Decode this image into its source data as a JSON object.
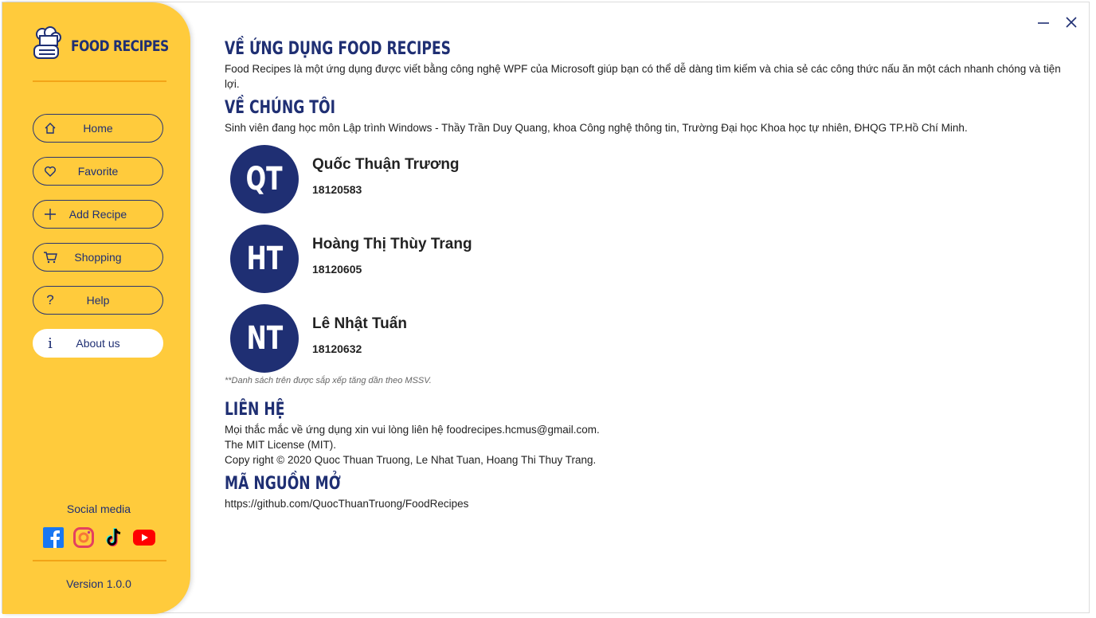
{
  "app": {
    "brand_title": "FOOD RECIPES",
    "version": "Version 1.0.0",
    "accent_color": "#FFCB3C",
    "primary_color": "#1F2F73"
  },
  "sidebar": {
    "items": [
      {
        "label": "Home",
        "icon": "home-icon"
      },
      {
        "label": "Favorite",
        "icon": "heart-icon"
      },
      {
        "label": "Add Recipe",
        "icon": "plus-icon"
      },
      {
        "label": "Shopping",
        "icon": "cart-icon"
      },
      {
        "label": "Help",
        "icon": "question-icon"
      },
      {
        "label": "About us",
        "icon": "info-icon",
        "active": true
      }
    ],
    "social_title": "Social media",
    "social": [
      "facebook-icon",
      "instagram-icon",
      "tiktok-icon",
      "youtube-icon"
    ]
  },
  "about": {
    "app_heading": "VỀ ỨNG DỤNG FOOD RECIPES",
    "app_text": "Food Recipes là một ứng dụng được viết bằng công nghệ WPF của Microsoft giúp bạn có thể dễ dàng tìm kiếm và chia sẻ các công thức nấu ăn một cách nhanh chóng và tiện lợi.",
    "team_heading": "VỀ CHÚNG TÔI",
    "team_text": "Sinh viên đang học môn Lập trình Windows - Thầy Trần Duy Quang, khoa Công nghệ thông tin, Trường Đại học Khoa học tự nhiên, ĐHQG TP.Hồ Chí Minh.",
    "members": [
      {
        "initials": "QT",
        "name": "Quốc Thuận Trương",
        "id": "18120583"
      },
      {
        "initials": "HT",
        "name": "Hoàng Thị Thùy Trang",
        "id": "18120605"
      },
      {
        "initials": "NT",
        "name": "Lê Nhật Tuấn",
        "id": "18120632"
      }
    ],
    "sort_note": "**Danh sách trên được sắp xếp tăng dần theo MSSV.",
    "contact_heading": "LIÊN HỆ",
    "contact_lines": [
      "Mọi thắc mắc về ứng dụng xin vui lòng liên hệ foodrecipes.hcmus@gmail.com.",
      "The MIT License (MIT).",
      "Copy right © 2020 Quoc Thuan Truong, Le Nhat Tuan, Hoang Thi Thuy Trang."
    ],
    "source_heading": "MÃ NGUỒN MỞ",
    "source_url": "https://github.com/QuocThuanTruong/FoodRecipes"
  }
}
